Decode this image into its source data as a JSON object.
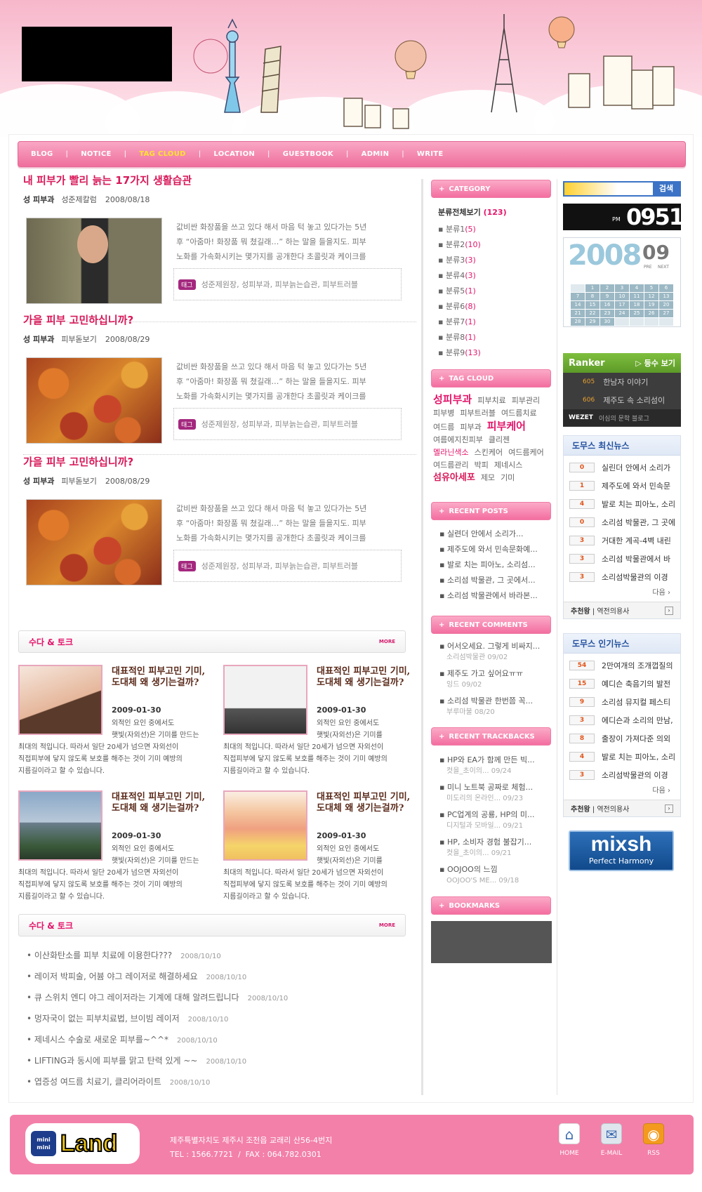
{
  "nav": {
    "items": [
      "BLOG",
      "NOTICE",
      "TAG CLOUD",
      "LOCATION",
      "GUESTBOOK",
      "ADMIN",
      "WRITE"
    ],
    "active_index": 2
  },
  "posts": [
    {
      "title": "내 피부가 빨리 늙는 17가지 생활습관",
      "author": "성 피부과",
      "category": "성준제칼럼",
      "date": "2008/08/18",
      "body": [
        "값비싼 화장품을 쓰고 있다 해서 마음 턱 놓고 있다가는 5년",
        "후 “아줌마! 화장품 뭐 쳤길래…” 하는 말을 들을지도. 피부",
        "노화를 가속화시키는 몇가지를 공개한다 초콜릿과 케이크를"
      ],
      "tag_label": "태그",
      "tags": "성준제원장, 성피부과, 피부늙는습관, 피부트러블",
      "image": "doctor-portrait"
    },
    {
      "title": "가을 피부 고민하십니까?",
      "author": "성 피부과",
      "category": "피부돋보기",
      "date": "2008/08/29",
      "body": [
        "값비싼 화장품을 쓰고 있다 해서 마음 턱 놓고 있다가는 5년",
        "후 “아줌마! 화장품 뭐 쳤길래…” 하는 말을 들을지도. 피부",
        "노화를 가속화시키는 몇가지를 공개한다 초콜릿과 케이크를"
      ],
      "tag_label": "태그",
      "tags": "성준제원장, 성피부과, 피부늙는습관, 피부트러블",
      "image": "autumn-leaves"
    },
    {
      "title": "가을 피부 고민하십니까?",
      "author": "성 피부과",
      "category": "피부돋보기",
      "date": "2008/08/29",
      "body": [
        "값비싼 화장품을 쓰고 있다 해서 마음 턱 놓고 있다가는 5년",
        "후 “아줌마! 화장품 뭐 쳤길래…” 하는 말을 들을지도. 피부",
        "노화를 가속화시키는 몇가지를 공개한다 초콜릿과 케이크를"
      ],
      "tag_label": "태그",
      "tags": "성준제원장, 성피부과, 피부늙는습관, 피부트러블",
      "image": "autumn-leaves"
    }
  ],
  "talk1": {
    "title": "수다 & 토크",
    "more": "MORE",
    "items": [
      {
        "title": "대표적인 피부고민 기미, 도대체 왜 생기는걸까?",
        "date": "2009-01-30",
        "lines": [
          "외적인 요인 중에서도",
          "햇빛(자외선)은          기미를 만드는"
        ],
        "full": [
          "최대의 적입니다. 따라서 일단 20세가 넘으면 자외선이",
          "직접피부에 닿지 않도록 보호를 해주는 것이 기미 예방의",
          "지름길이라고 할 수 있습니다."
        ],
        "image": "woman-face"
      },
      {
        "title": "대표적인 피부고민 기미, 도대체 왜 생기는걸까?",
        "date": "2009-01-30",
        "lines": [
          "외적인 요인 중에서도",
          "햇빛(자외선)은          기미를"
        ],
        "full": [
          "최대의 적입니다. 따라서 일단 20세가 넘으면 자외선이",
          "직접피부에 닿지 않도록 보호를 해주는 것이 기미 예방의",
          "지름길이라고 할 수 있습니다."
        ],
        "image": "laser-machine"
      },
      {
        "title": "대표적인 피부고민 기미, 도대체 왜 생기는걸까?",
        "date": "2009-01-30",
        "lines": [
          "외적인 요인 중에서도",
          "햇빛(자외선)은          기미를 만드는"
        ],
        "full": [
          "최대의 적입니다. 따라서 일단 20세가 넘으면 자외선이",
          "직접피부에 닿지 않도록 보호를 해주는 것이 기미 예방의",
          "지름길이라고 할 수 있습니다."
        ],
        "image": "seaside"
      },
      {
        "title": "대표적인 피부고민 기미, 도대체 왜 생기는걸까?",
        "date": "2009-01-30",
        "lines": [
          "외적인 요인 중에서도",
          "햇빛(자외선)은          기미를"
        ],
        "full": [
          "최대의 적입니다. 따라서 일단 20세가 넘으면 자외선이",
          "직접피부에 닿지 않도록 보호를 해주는 것이 기미 예방의",
          "지름길이라고 할 수 있습니다."
        ],
        "image": "skin-diagram"
      }
    ]
  },
  "talk2": {
    "title": "수다 & 토크",
    "more": "MORE",
    "items": [
      {
        "text": "이산화탄소를 피부 치료에 이용한다???",
        "date": "2008/10/10"
      },
      {
        "text": "레이저 박피술, 어븀 야그 레이저로 해결하세요",
        "date": "2008/10/10"
      },
      {
        "text": "큐 스위치 엔디 야그 레이저라는 기계에 대해 알려드립니다",
        "date": "2008/10/10"
      },
      {
        "text": "멍자국이 없는 피부치료법, 브이빔 레이저",
        "date": "2008/10/10"
      },
      {
        "text": "제네시스 수술로 새로운 피부를~^^*",
        "date": "2008/10/10"
      },
      {
        "text": "LIFTING과 동시에 피부를 맑고 탄력 있게 ~~",
        "date": "2008/10/10"
      },
      {
        "text": "엽증성 여드름 치료기, 클리어라이트",
        "date": "2008/10/10"
      }
    ]
  },
  "sidebar": {
    "category_title": "CATEGORY",
    "all_label": "분류전체보기",
    "all_count": "(123)",
    "categories": [
      {
        "name": "분류1",
        "count": "(5)"
      },
      {
        "name": "분류2",
        "count": "(10)"
      },
      {
        "name": "분류3",
        "count": "(3)"
      },
      {
        "name": "분류4",
        "count": "(3)"
      },
      {
        "name": "분류5",
        "count": "(1)"
      },
      {
        "name": "분류6",
        "count": "(8)"
      },
      {
        "name": "분류7",
        "count": "(1)"
      },
      {
        "name": "분류8",
        "count": "(1)"
      },
      {
        "name": "분류9",
        "count": "(13)"
      }
    ],
    "tag_cloud_title": "TAG CLOUD",
    "recent_posts_title": "RECENT POSTS",
    "recent_posts": [
      "실련더 안에서 소리가...",
      "제주도에 와서 민속문화예...",
      "발로 치는 피아노, 소리섬...",
      "소리섬 박물관, 그 곳에서...",
      "소리섬 박물관에서 바라본..."
    ],
    "recent_comments_title": "RECENT COMMENTS",
    "recent_comments": [
      {
        "text": "어서오세요. 그렇게 비싸지...",
        "sub": "소리섬박물관 09/02"
      },
      {
        "text": "제주도 가고 싶어요ㅠㅠ",
        "sub": "잉드 09/02"
      },
      {
        "text": "소리섬 박물관 한번쯤 꼭...",
        "sub": "부루마불 08/20"
      }
    ],
    "recent_trackbacks_title": "RECENT TRACKBACKS",
    "recent_trackbacks": [
      {
        "text": "HP와 EA가 함께 만든 빅...",
        "sub": "컷을_초이의... 09/24"
      },
      {
        "text": "미니 노트북 공짜로 체험...",
        "sub": "미도리의 온라인... 09/23"
      },
      {
        "text": "PC업계의 공룡, HP의 미...",
        "sub": "디지털과 모바일... 09/21"
      },
      {
        "text": "HP, 소비자 경험 불잡기...",
        "sub": "컷을_초이의... 09/21"
      },
      {
        "text": "OOJOO의 느낌",
        "sub": "OOJOO'S ME... 09/18"
      }
    ],
    "bookmarks_title": "BOOKMARKS"
  },
  "tag_cloud": [
    {
      "t": "성피부과",
      "c": "#e4156a",
      "s": 15
    },
    {
      "t": "피부치료",
      "c": "#666",
      "s": 11
    },
    {
      "t": "피부관리",
      "c": "#666",
      "s": 11
    },
    {
      "t": "피부병",
      "c": "#666",
      "s": 11
    },
    {
      "t": "피부트러블",
      "c": "#666",
      "s": 11
    },
    {
      "t": "여드름치료",
      "c": "#666",
      "s": 11
    },
    {
      "t": "여드름",
      "c": "#666",
      "s": 11
    },
    {
      "t": "피부과",
      "c": "#666",
      "s": 11
    },
    {
      "t": "피부케어",
      "c": "#e4156a",
      "s": 15
    },
    {
      "t": "여름에지친피부",
      "c": "#666",
      "s": 11
    },
    {
      "t": "클리젠",
      "c": "#666",
      "s": 11
    },
    {
      "t": "멜라닌색소",
      "c": "#e4156a",
      "s": 11
    },
    {
      "t": "스킨케어",
      "c": "#666",
      "s": 11
    },
    {
      "t": "여드름케어",
      "c": "#666",
      "s": 11
    },
    {
      "t": "여드름관리",
      "c": "#666",
      "s": 11
    },
    {
      "t": "박피",
      "c": "#666",
      "s": 11
    },
    {
      "t": "제네시스",
      "c": "#666",
      "s": 11
    },
    {
      "t": "섬유아세포",
      "c": "#d8195a",
      "s": 13
    },
    {
      "t": "제모",
      "c": "#666",
      "s": 11
    },
    {
      "t": "기미",
      "c": "#666",
      "s": 11
    }
  ],
  "widgets": {
    "search_button": "검색",
    "clock_ampm": "PM",
    "clock_time": "0951",
    "cal_year": "2008",
    "cal_month": "09",
    "cal_prev": "PRE",
    "cal_next": "NEXT",
    "cal_weeks": [
      [
        "",
        "1",
        "2",
        "3",
        "4",
        "5",
        "6"
      ],
      [
        "7",
        "8",
        "9",
        "10",
        "11",
        "12",
        "13"
      ],
      [
        "14",
        "15",
        "16",
        "17",
        "18",
        "19",
        "20"
      ],
      [
        "21",
        "22",
        "23",
        "24",
        "25",
        "26",
        "27"
      ],
      [
        "28",
        "29",
        "30",
        "",
        "",
        "",
        ""
      ]
    ],
    "ranker_title": "Ranker",
    "ranker_more": "▷ 등수 보기",
    "ranker_rows": [
      {
        "n": "605",
        "t": "한남자 이야기"
      },
      {
        "n": "606",
        "t": "제주도 속 소리섬이"
      }
    ],
    "wezet": "WEZET",
    "wezet_text": "이심의 문학 블로그"
  },
  "news": {
    "title": "도무스 최신뉴스",
    "rows": [
      {
        "c": "0",
        "t": "실린더 안에서 소리가"
      },
      {
        "c": "1",
        "t": "제주도에 와서 민속문"
      },
      {
        "c": "4",
        "t": "발로 치는 피아노, 소리"
      },
      {
        "c": "0",
        "t": "소리섬 박물관, 그 곳에"
      },
      {
        "c": "3",
        "t": "거대한 계곡-4벽 내린"
      },
      {
        "c": "3",
        "t": "소리섬 박물관에서 바"
      },
      {
        "c": "3",
        "t": "소리섬박물관의 이경"
      }
    ],
    "more": "다음 ›",
    "foot": "추천왕",
    "foot2": "역전의용사"
  },
  "popular": {
    "title": "도무스 인기뉴스",
    "rows": [
      {
        "c": "54",
        "t": "2만여개의 조개껍질의"
      },
      {
        "c": "15",
        "t": "예디슨 축음기의 발전"
      },
      {
        "c": "9",
        "t": "소리섬 뮤지컬 페스티"
      },
      {
        "c": "3",
        "t": "에디슨과 소리의 만남,"
      },
      {
        "c": "8",
        "t": "출장이 가져다준 의외"
      },
      {
        "c": "4",
        "t": "발로 치는 피아노, 소리"
      },
      {
        "c": "3",
        "t": "소리섬박물관의 이경"
      }
    ],
    "more": "다음 ›",
    "foot": "추천왕",
    "foot2": "역전의용사"
  },
  "mixsh": {
    "big": "mixsh",
    "small": "Perfect Harmony"
  },
  "footer": {
    "logo_small": "mini mini",
    "logo_big": "Land",
    "address": "제주특별자치도 제주시 조천읍 교래리 산56-4번지",
    "contact": "TEL : 1566.7721  /  FAX : 064.782.0301",
    "icons": [
      {
        "label": "HOME",
        "icon": "home-icon"
      },
      {
        "label": "E-MAIL",
        "icon": "email-icon"
      },
      {
        "label": "RSS",
        "icon": "rss-icon"
      }
    ]
  }
}
